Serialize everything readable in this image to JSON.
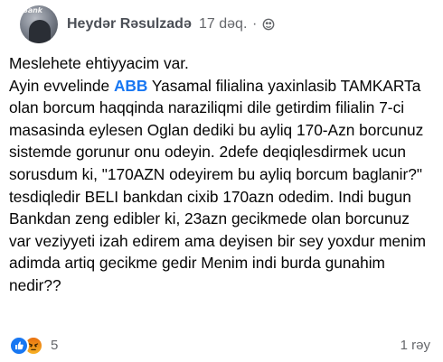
{
  "header": {
    "avatar_logo_text": "Bank",
    "author": "Heydər Rəsulzadə",
    "separator": "·",
    "time": "17 dəq.",
    "separator2": "·",
    "audience_icon": "globe-icon"
  },
  "post": {
    "line1": "Meslehete ehtiyyacim var.",
    "line2_before": "Ayin evvelinde ",
    "line2_link": "ABB",
    "line2_after": " Yasamal filialina yaxinlasib TAMKARTa olan borcum haqqinda naraziliqmi dile getirdim filialin 7-ci masasinda eylesen Oglan dediki bu ayliq 170-Azn borcunuz sistemde gorunur onu odeyin. 2defe deqiqlesdirmek ucun sorusdum ki, \"170AZN odeyirem bu ayliq borcum baglanir?\" tesdiqledir BELI bankdan cixib 170azn odedim. Indi bugun Bankdan zeng edibler ki, 23azn gecikmede olan borcunuz var veziyyeti izah edirem ama deyisen bir sey yoxdur menim adimda artiq gecikme gedir Menim indi burda gunahim nedir??"
  },
  "footer": {
    "reaction_icons": [
      "like-icon",
      "angry-icon"
    ],
    "reaction_count": "5",
    "reply_count": "1 rəy"
  },
  "colors": {
    "link": "#1877f2",
    "secondary_text": "#65676b",
    "like_blue": "#1877f2",
    "angry_orange": "#f7b125"
  }
}
